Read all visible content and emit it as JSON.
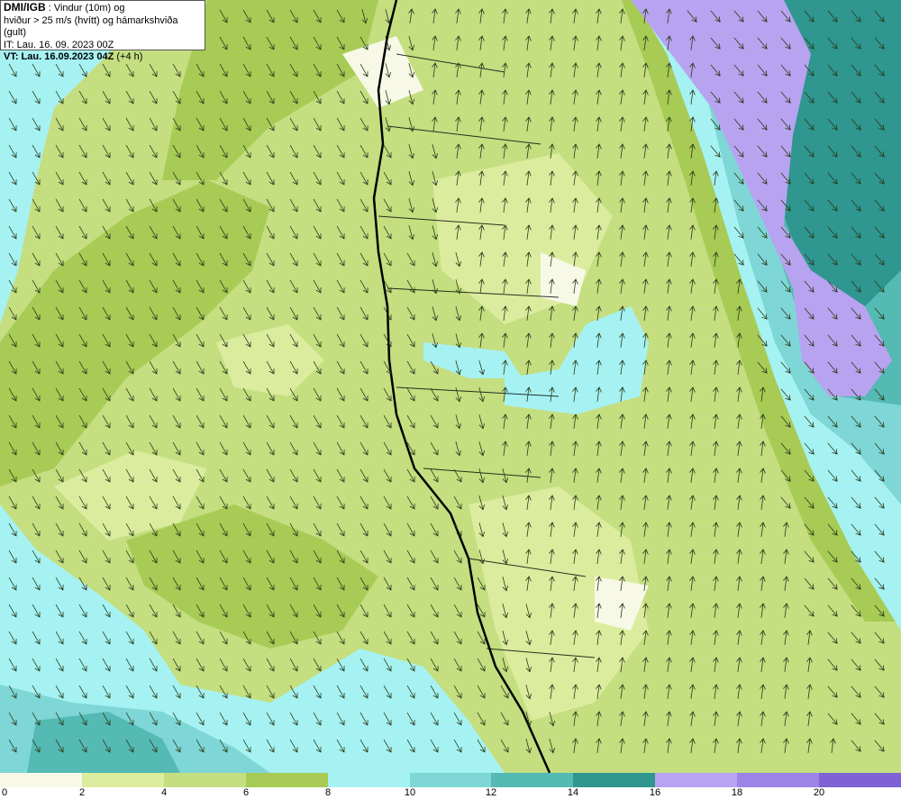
{
  "header": {
    "title": "DMI/IGB",
    "title_rest": " : Vindur (10m) og",
    "line2": "hviður > 25 m/s (hvítt) og hámarkshviða (gult)",
    "line3": "IT: Lau. 16. 09. 2023 00Z",
    "line4_bold": "VT: Lau. 16.09.2023 04Z",
    "line4_rest": " (+4 h)"
  },
  "legend": {
    "labels": [
      "0",
      "2",
      "4",
      "6",
      "8",
      "10",
      "12",
      "14",
      "16",
      "18",
      "20"
    ],
    "colors": [
      "#f7f9e6",
      "#dcec9e",
      "#c4de80",
      "#a7cb55",
      "#a6f2f2",
      "#7fd6d6",
      "#55b9b4",
      "#2f9690",
      "#b8a3f0",
      "#9c84e6",
      "#7e62d6"
    ]
  },
  "colors": {
    "sea_calm": "#a6f2f2",
    "land_light": "#c4de80",
    "land_mid": "#a7cb55",
    "coast_line": "#000000",
    "arrow": "#2a3a1a"
  }
}
